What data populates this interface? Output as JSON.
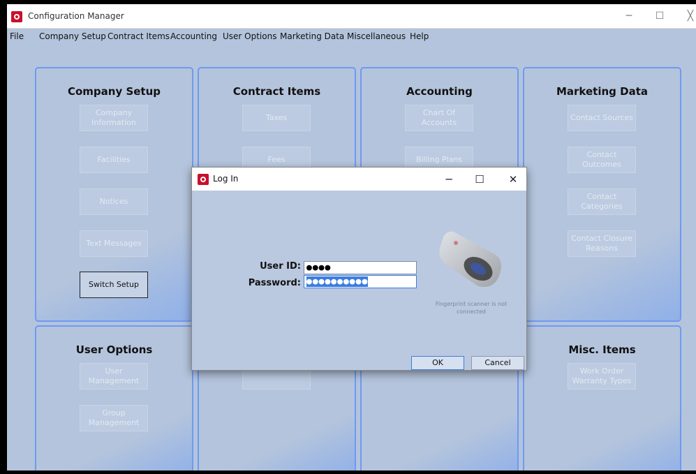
{
  "window": {
    "title": "Configuration Manager",
    "minimize": "─",
    "maximize": "☐",
    "close": "╳"
  },
  "menu": [
    "File",
    "Company Setup",
    "Contract Items",
    "Accounting",
    "User Options",
    "Marketing Data",
    "Miscellaneous",
    "Help"
  ],
  "panels": {
    "company_setup": {
      "title": "Company Setup",
      "buttons": [
        "Company Information",
        "Facilities",
        "Notices",
        "Text Messages",
        "Switch Setup"
      ]
    },
    "contract_items": {
      "title": "Contract Items",
      "buttons": [
        "Taxes",
        "Fees",
        ""
      ]
    },
    "accounting": {
      "title": "Accounting",
      "buttons": [
        "Chart Of Accounts",
        "Billing Plans"
      ]
    },
    "marketing_data": {
      "title": "Marketing Data",
      "buttons": [
        "Contact Sources",
        "Contact Outcomes",
        "Contact Categories",
        "Contact Closure Reasons"
      ]
    },
    "user_options": {
      "title": "User Options",
      "buttons": [
        "User Management",
        "Group Management"
      ]
    },
    "misc_items": {
      "title": "Misc. Items",
      "buttons": [
        "Work Order Warranty Types"
      ]
    }
  },
  "login": {
    "title": "Log In",
    "minimize": "─",
    "maximize": "☐",
    "close": "✕",
    "user_id_label": "User ID:",
    "user_id_value": "●●●●",
    "password_label": "Password:",
    "password_value": "●●●●●●●●●●",
    "scanner_message": "Fingerprint scanner is not connected",
    "ok": "OK",
    "cancel": "Cancel"
  },
  "colors": {
    "background": "#b4c4dc",
    "panel_border": "#6e9af2",
    "focus_accent": "#3b7de0",
    "app_icon": "#c8102e"
  },
  "icons": {
    "app": "app-logo-icon",
    "scanner": "fingerprint-scanner-icon"
  }
}
